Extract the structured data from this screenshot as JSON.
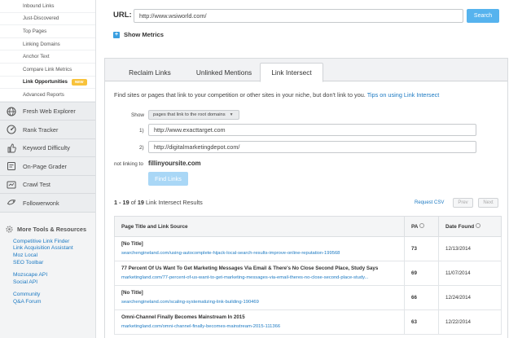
{
  "sidebar": {
    "sub_items": [
      {
        "label": "Inbound Links"
      },
      {
        "label": "Just-Discovered"
      },
      {
        "label": "Top Pages"
      },
      {
        "label": "Linking Domains"
      },
      {
        "label": "Anchor Text"
      },
      {
        "label": "Compare Link Metrics"
      },
      {
        "label": "Link Opportunities",
        "badge": "NEW",
        "active": true
      },
      {
        "label": "Advanced Reports"
      }
    ],
    "tools": [
      {
        "label": "Fresh Web Explorer",
        "icon": "globe-icon"
      },
      {
        "label": "Rank Tracker",
        "icon": "gauge-icon"
      },
      {
        "label": "Keyword Difficulty",
        "icon": "thumb-icon"
      },
      {
        "label": "On-Page Grader",
        "icon": "grader-icon"
      },
      {
        "label": "Crawl Test",
        "icon": "crawl-icon"
      },
      {
        "label": "Followerwonk",
        "icon": "followerwonk-icon"
      }
    ],
    "more_header": "More Tools & Resources",
    "more_groups": [
      [
        "Competitive Link Finder",
        "Link Acquisition Assistant",
        "Moz Local",
        "SEO Toolbar"
      ],
      [
        "Mozscape API",
        "Social API"
      ],
      [
        "Community",
        "Q&A Forum"
      ]
    ]
  },
  "top": {
    "url_label": "URL:",
    "url_value": "http://www.wsiworld.com/",
    "search_label": "Search",
    "show_metrics": "Show Metrics"
  },
  "tabs": [
    {
      "label": "Reclaim Links"
    },
    {
      "label": "Unlinked Mentions"
    },
    {
      "label": "Link Intersect",
      "active": true
    }
  ],
  "form": {
    "intro": "Find sites or pages that link to your competition or other sites in your niche, but don't link to you.",
    "intro_link": "Tips on using Link Intersect",
    "show_label": "Show",
    "show_value": "pages that link to the root domains",
    "comp1_label": "1)",
    "comp1_value": "http://www.exacttarget.com",
    "comp2_label": "2)",
    "comp2_value": "http://digitalmarketingdepot.com/",
    "not_linking_label": "not linking to",
    "own_site": "fillinyoursite.com",
    "find_button": "Find Links"
  },
  "results": {
    "range": "1 - 19",
    "of": "of",
    "total": "19",
    "suffix": "Link Intersect Results",
    "request_csv": "Request CSV",
    "prev": "Prev",
    "next": "Next",
    "headers": {
      "title": "Page Title and Link Source",
      "pa": "PA",
      "date": "Date Found"
    },
    "rows": [
      {
        "title": "[No Title]",
        "url": "searchengineland.com/using-autocomplete-hijack-local-search-results-improve-online-reputation-199568",
        "pa": "73",
        "date": "12/13/2014"
      },
      {
        "title": "77 Percent Of Us Want To Get Marketing Messages Via Email & There's No Close Second Place, Study Says",
        "url": "marketingland.com/77-percent-of-us-want-to-get-marketing-messages-via-email-theres-no-close-second-place-study...",
        "pa": "69",
        "date": "11/07/2014"
      },
      {
        "title": "[No Title]",
        "url": "searchengineland.com/scaling-systematizing-link-building-190469",
        "pa": "66",
        "date": "12/24/2014"
      },
      {
        "title": "Omni-Channel Finally Becomes Mainstream In 2015",
        "url": "marketingland.com/omni-channel-finally-becomes-mainstream-2015-111366",
        "pa": "63",
        "date": "12/22/2014"
      }
    ]
  }
}
